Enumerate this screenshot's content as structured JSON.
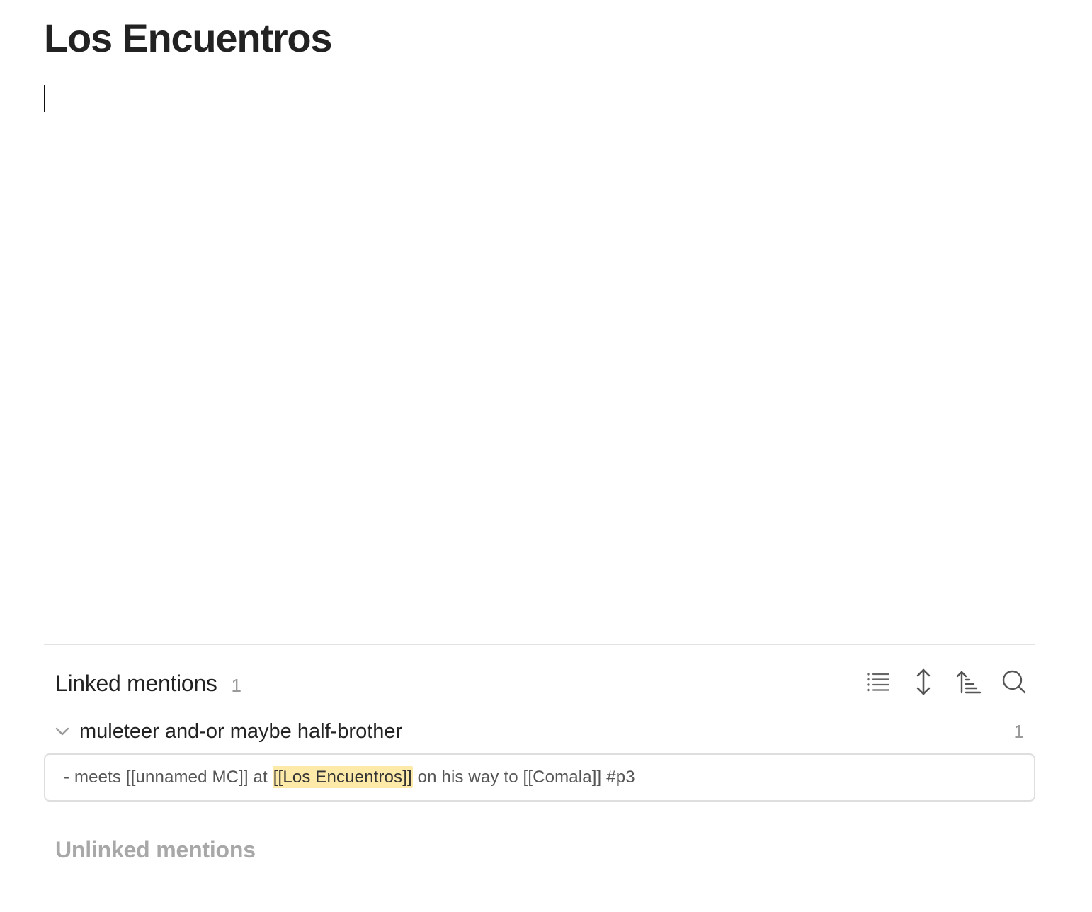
{
  "page": {
    "title": "Los Encuentros"
  },
  "linked_mentions": {
    "title": "Linked mentions",
    "count": "1",
    "toolbar": {
      "icons": [
        "list-icon",
        "expand-collapse-icon",
        "sort-icon",
        "search-icon"
      ]
    },
    "groups": [
      {
        "label": "muleteer and-or maybe half-brother",
        "count": "1",
        "expanded": true,
        "mention": {
          "before": "- meets [[unnamed MC]] at ",
          "highlight": "[[Los Encuentros]]",
          "after": " on his way to [[Comala]] #p3"
        }
      }
    ]
  },
  "unlinked_mentions": {
    "title": "Unlinked mentions"
  },
  "colors": {
    "text_primary": "#222222",
    "text_muted": "#9a9a9a",
    "highlight": "#fde9a8",
    "divider": "#e3e3e3",
    "icon": "#666666"
  }
}
